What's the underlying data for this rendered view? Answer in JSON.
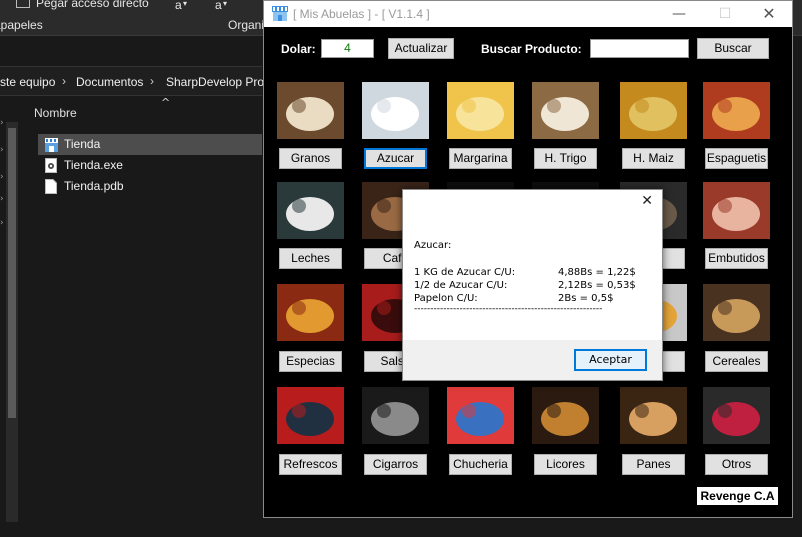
{
  "explorer": {
    "ribbon": {
      "pin_shortcut": "Pegar acceso directo",
      "clipboard_group": "apapeles",
      "organize_group": "Organi",
      "rename_a1": "a",
      "rename_a2": "a"
    },
    "breadcrumb": [
      "ste equipo",
      "Documentos",
      "SharpDevelop Proj"
    ],
    "column_header": "Nombre",
    "files": [
      {
        "name": "Tienda",
        "icon": "app-store-icon",
        "selected": true
      },
      {
        "name": "Tienda.exe",
        "icon": "exe-file-icon",
        "selected": false
      },
      {
        "name": "Tienda.pdb",
        "icon": "document-icon",
        "selected": false
      }
    ]
  },
  "app": {
    "title": "[ Mis Abuelas ] - [ V1.1.4 ]",
    "dolar_label": "Dolar:",
    "dolar_value": "4",
    "update_button": "Actualizar",
    "search_label": "Buscar Producto:",
    "search_value": "",
    "search_button": "Buscar",
    "brand": "Revenge C.A",
    "categories": [
      {
        "label": "Granos"
      },
      {
        "label": "Azucar"
      },
      {
        "label": "Margarina"
      },
      {
        "label": "H. Trigo"
      },
      {
        "label": "H. Maiz"
      },
      {
        "label": "Espaguetis"
      },
      {
        "label": "Leches"
      },
      {
        "label": "Cafe"
      },
      {
        "label": ""
      },
      {
        "label": ""
      },
      {
        "label": "os"
      },
      {
        "label": "Embutidos"
      },
      {
        "label": "Especias"
      },
      {
        "label": "Salsa"
      },
      {
        "label": ""
      },
      {
        "label": ""
      },
      {
        "label": "nas"
      },
      {
        "label": "Cereales"
      },
      {
        "label": "Refrescos"
      },
      {
        "label": "Cigarros"
      },
      {
        "label": "Chucheria"
      },
      {
        "label": "Licores"
      },
      {
        "label": "Panes"
      },
      {
        "label": "Otros"
      }
    ]
  },
  "dialog": {
    "heading": "Azucar:",
    "rows": [
      {
        "label": "1 KG de Azucar C/U:",
        "value": "4,88Bs = 1,22$"
      },
      {
        "label": "1/2 de Azucar C/U:",
        "value": "2,12Bs = 0,53$"
      },
      {
        "label": "Papelon C/U:",
        "value": "2Bs = 0,5$"
      }
    ],
    "separator": "----------------------------------------------------------",
    "ok_button": "Aceptar"
  },
  "colors": {
    "accent": "#0078d7",
    "dolar_text": "#107a10",
    "app_background": "#000000",
    "explorer_background": "#191919",
    "selected_row": "#4d4d4d"
  }
}
